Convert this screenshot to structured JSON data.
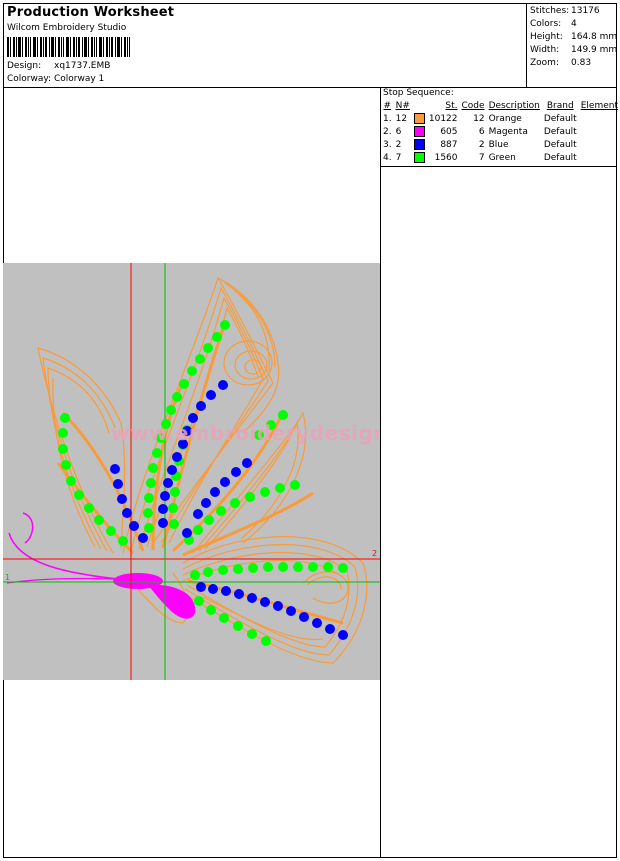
{
  "header": {
    "title": "Production Worksheet",
    "software": "Wilcom Embroidery Studio",
    "design_label": "Design:",
    "design_value": "xq1737.EMB",
    "colorway_label": "Colorway:",
    "colorway_value": "Colorway 1"
  },
  "stats": [
    {
      "label": "Stitches:",
      "value": "13176"
    },
    {
      "label": "Colors:",
      "value": "4"
    },
    {
      "label": "Height:",
      "value": "164.8 mm"
    },
    {
      "label": "Width:",
      "value": "149.9 mm"
    },
    {
      "label": "Zoom:",
      "value": "0.83"
    }
  ],
  "stop_sequence": {
    "title": "Stop Sequence:",
    "headers": [
      "#",
      "N#",
      "St.",
      "Code",
      "Description",
      "Brand",
      "Element"
    ],
    "rows": [
      {
        "num": "1.",
        "n": "12",
        "color": "#f99b3a",
        "st": "10122",
        "code": "12",
        "desc": "Orange",
        "brand": "Default"
      },
      {
        "num": "2.",
        "n": "6",
        "color": "#ff00ff",
        "st": "605",
        "code": "6",
        "desc": "Magenta",
        "brand": "Default"
      },
      {
        "num": "3.",
        "n": "2",
        "color": "#0000ff",
        "st": "887",
        "code": "2",
        "desc": "Blue",
        "brand": "Default"
      },
      {
        "num": "4.",
        "n": "7",
        "color": "#00ff00",
        "st": "1560",
        "code": "7",
        "desc": "Green",
        "brand": "Default"
      }
    ]
  },
  "canvas": {
    "background": "#c0c0c0",
    "watermark": "www.embroiderydesigns.com",
    "axis_label_1": "1",
    "axis_label_2": "2"
  },
  "colors": {
    "orange": "#f99b3a",
    "magenta": "#ff00ff",
    "blue": "#0000ff",
    "green": "#00ff00",
    "red_axis": "#ff0000",
    "green_axis": "#00c000"
  }
}
